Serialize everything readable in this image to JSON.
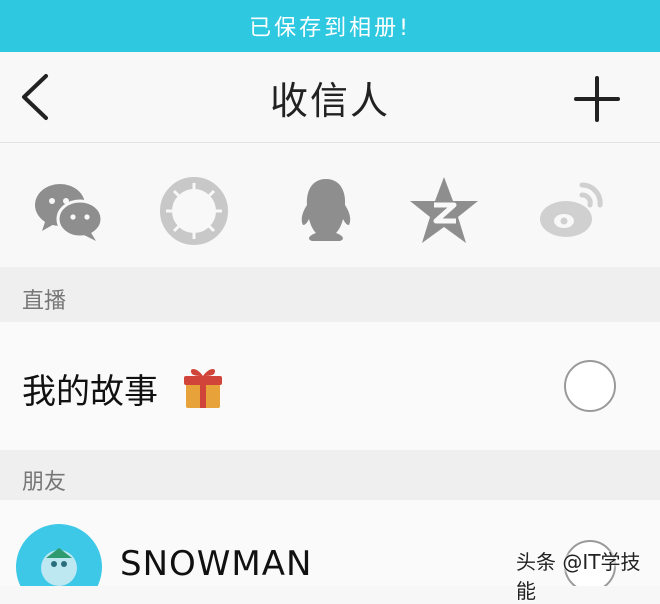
{
  "toast": {
    "message": "已保存到相册!"
  },
  "navbar": {
    "title": "收信人",
    "back_icon": "chevron-left-icon",
    "add_icon": "plus-icon"
  },
  "share_targets": [
    {
      "icon": "wechat-icon"
    },
    {
      "icon": "moments-icon"
    },
    {
      "icon": "qq-icon"
    },
    {
      "icon": "qzone-icon"
    },
    {
      "icon": "weibo-icon"
    }
  ],
  "sections": {
    "live": {
      "header": "直播",
      "story_label": "我的故事",
      "story_icon": "gift-icon"
    },
    "friends": {
      "header": "朋友",
      "first_friend": "SNOWMAN"
    }
  },
  "watermark": "头条 @IT学技能",
  "colors": {
    "accent": "#2ec8e0",
    "icon_gray": "#8e8e8e",
    "background": "#f7f7f7"
  }
}
